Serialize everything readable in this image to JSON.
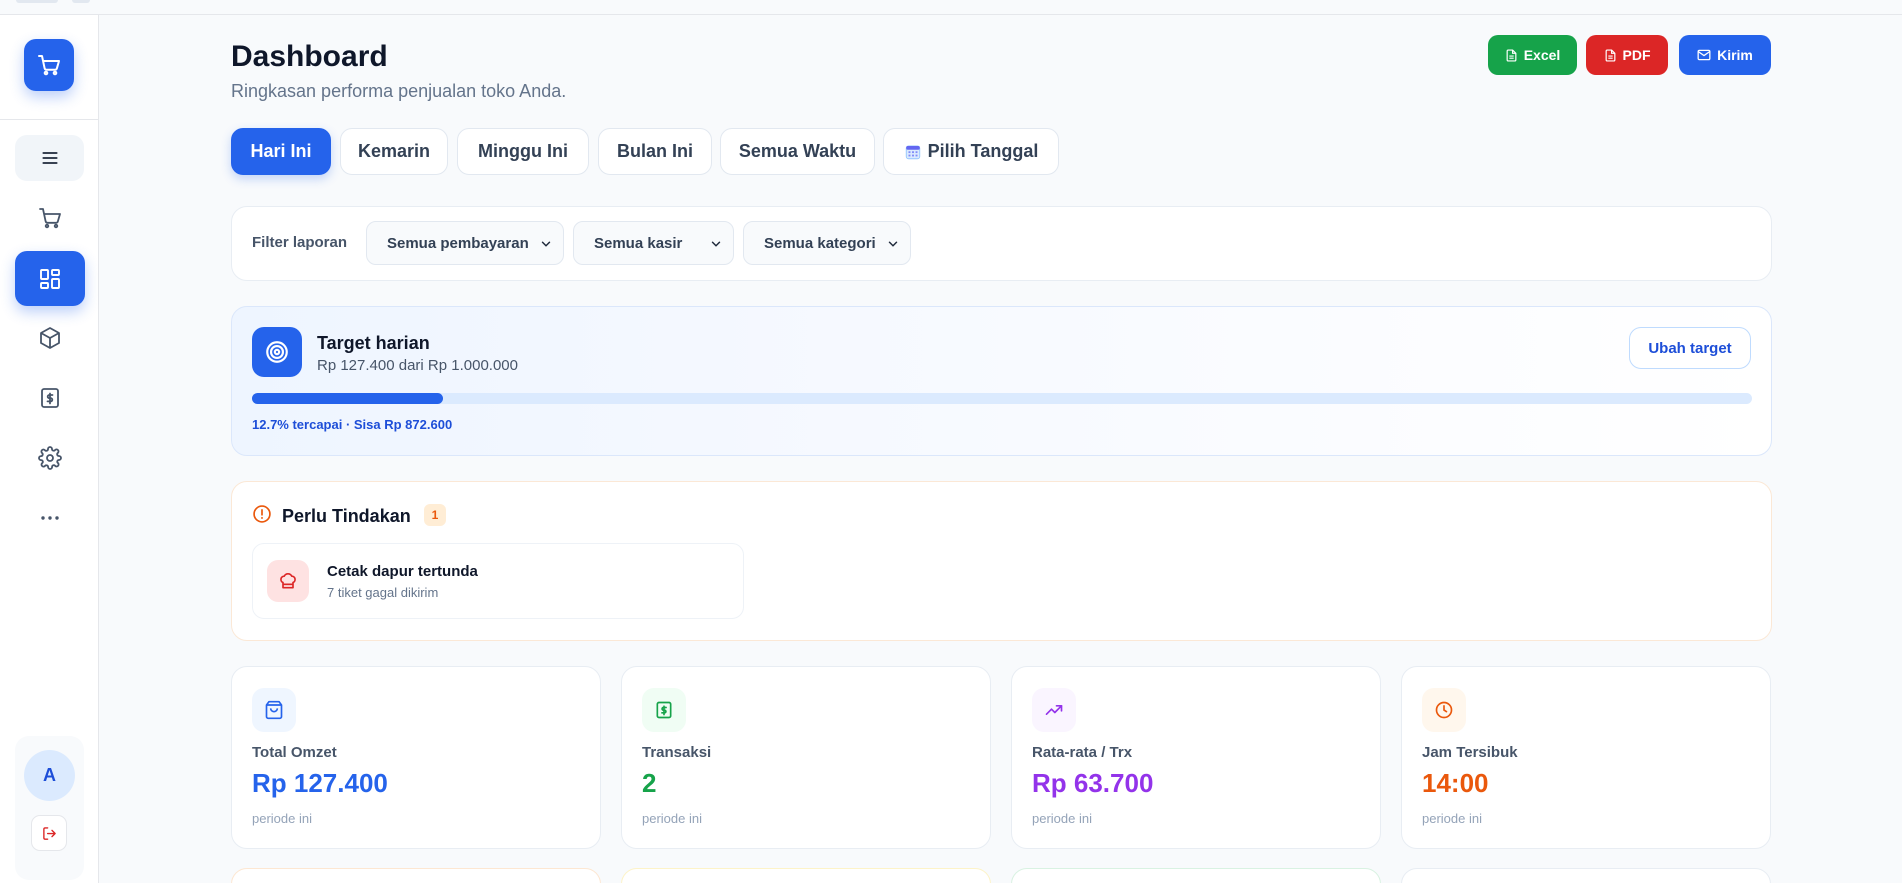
{
  "colors": {
    "primary": "#2563eb",
    "excel": "#16a34a",
    "pdf": "#dc2626",
    "omzet": "#2563eb",
    "transaksi": "#16a34a",
    "rata_rata": "#9333ea",
    "jam": "#ea580c"
  },
  "sidebar": {
    "icons": [
      "cart-icon",
      "menu-icon",
      "cart-icon",
      "dashboard-grid-icon",
      "box-icon",
      "receipt-icon",
      "gear-icon",
      "more-icon",
      "logout-icon"
    ],
    "active_item": "dashboard",
    "avatar_initial": "A"
  },
  "header": {
    "title": "Dashboard",
    "subtitle": "Ringkasan performa penjualan toko Anda.",
    "actions": {
      "excel": "Excel",
      "pdf": "PDF",
      "kirim": "Kirim"
    }
  },
  "tabs": [
    {
      "label": "Hari Ini",
      "active": true
    },
    {
      "label": "Kemarin"
    },
    {
      "label": "Minggu Ini"
    },
    {
      "label": "Bulan Ini"
    },
    {
      "label": "Semua Waktu"
    },
    {
      "label": "Pilih Tanggal",
      "icon": "calendar-icon"
    }
  ],
  "filters": {
    "label": "Filter laporan",
    "payment": "Semua pembayaran",
    "cashier": "Semua kasir",
    "category": "Semua kategori"
  },
  "target": {
    "title": "Target harian",
    "subtitle": "Rp 127.400 dari Rp 1.000.000",
    "button": "Ubah target",
    "progress_percent": 12.7,
    "progress_text": "12.7% tercapai · Sisa Rp 872.600"
  },
  "action": {
    "title": "Perlu Tindakan",
    "count": "1",
    "item": {
      "title": "Cetak dapur tertunda",
      "subtitle": "7 tiket gagal dikirim"
    }
  },
  "stats": [
    {
      "label": "Total Omzet",
      "value": "Rp 127.400",
      "note": "periode ini",
      "icon": "shopping-bag-icon"
    },
    {
      "label": "Transaksi",
      "value": "2",
      "note": "periode ini",
      "icon": "receipt-dollar-icon"
    },
    {
      "label": "Rata-rata / Trx",
      "value": "Rp 63.700",
      "note": "periode ini",
      "icon": "trending-up-icon"
    },
    {
      "label": "Jam Tersibuk",
      "value": "14:00",
      "note": "periode ini",
      "icon": "clock-icon"
    }
  ]
}
